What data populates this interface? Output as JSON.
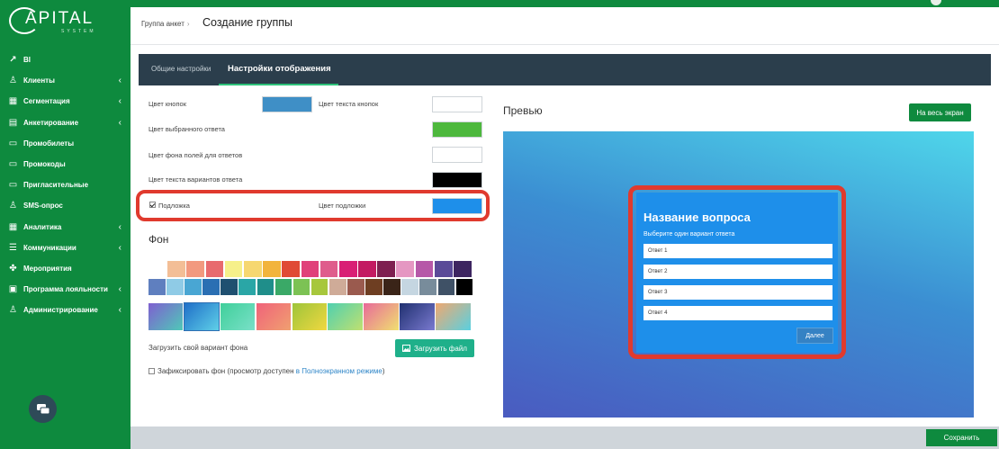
{
  "app": {
    "logo_text": "APITAL",
    "logo_sub": "SYSTEM"
  },
  "sidebar": {
    "items": [
      {
        "label": "BI",
        "icon": "chart-line-icon",
        "chevron": false
      },
      {
        "label": "Клиенты",
        "icon": "user-icon",
        "chevron": true
      },
      {
        "label": "Сегментация",
        "icon": "sitemap-icon",
        "chevron": true
      },
      {
        "label": "Анкетирование",
        "icon": "form-icon",
        "chevron": true
      },
      {
        "label": "Промобилеты",
        "icon": "ticket-icon",
        "chevron": false
      },
      {
        "label": "Промокоды",
        "icon": "ticket-icon",
        "chevron": false
      },
      {
        "label": "Пригласительные",
        "icon": "ticket-icon",
        "chevron": false
      },
      {
        "label": "SMS-опрос",
        "icon": "user-icon",
        "chevron": false
      },
      {
        "label": "Аналитика",
        "icon": "sitemap-icon",
        "chevron": true
      },
      {
        "label": "Коммуникации",
        "icon": "list-icon",
        "chevron": true
      },
      {
        "label": "Мероприятия",
        "icon": "handshake-icon",
        "chevron": false
      },
      {
        "label": "Программа лояльности",
        "icon": "gift-icon",
        "chevron": true
      },
      {
        "label": "Администрирование",
        "icon": "user-icon",
        "chevron": true
      }
    ]
  },
  "header": {
    "breadcrumb": "Группа анкет",
    "breadcrumb_sep": "›",
    "title": "Создание группы"
  },
  "tabs": [
    {
      "label": "Общие настройки",
      "active": false
    },
    {
      "label": "Настройки отображения",
      "active": true
    }
  ],
  "settings": {
    "button_color_label": "Цвет кнопок",
    "button_color": "#3f8fc6",
    "button_text_color_label": "Цвет текста кнопок",
    "button_text_color": "#ffffff",
    "selected_answer_label": "Цвет выбранного ответа",
    "selected_answer_color": "#4db83d",
    "answer_bg_label": "Цвет фона полей для ответов",
    "answer_bg_color": "#ffffff",
    "variant_text_label": "Цвет текста вариантов ответа",
    "variant_text_color": "#000000",
    "underlay_label": "Подложка",
    "underlay_checked": true,
    "underlay_color_label": "Цвет подложки",
    "underlay_color": "#1e8fea",
    "highlight_color": "#e03a2e"
  },
  "background": {
    "title": "Фон",
    "palette_row1": [
      "#ffffff",
      "#f3be96",
      "#f2997f",
      "#e86a6e",
      "#f6f08a",
      "#f6d770",
      "#f2b43c",
      "#e04a35",
      "#e0417a",
      "#df5d8c",
      "#d91f75",
      "#c31a62",
      "#7e2050",
      "#e597c2",
      "#b658a8",
      "#5a4a98",
      "#3d2560"
    ],
    "palette_row2": [
      "#5f7fbf",
      "#8fcbe6",
      "#49a6d3",
      "#2a6fb3",
      "#1f5070",
      "#2aa6a6",
      "#1f8e8a",
      "#3aa967",
      "#7cc254",
      "#a7c73c",
      "#cfab98",
      "#9a5a4e",
      "#6e3e22",
      "#3a2418",
      "#c5d6e1",
      "#788c9b",
      "#3f5166",
      "#000000"
    ],
    "gradients": [
      [
        "#7f5fd0",
        "#4fc9b8"
      ],
      [
        "#1f6fc8",
        "#5fd0e8"
      ],
      [
        "#3fcf9a",
        "#7ae0c8"
      ],
      [
        "#f0627a",
        "#f0a070"
      ],
      [
        "#9ec43a",
        "#f0d840"
      ],
      [
        "#4fd0b0",
        "#c0e070"
      ],
      [
        "#e86a9a",
        "#f0e070"
      ],
      [
        "#203070",
        "#7a7ad0"
      ],
      [
        "#f0a870",
        "#5ad0e0"
      ]
    ],
    "upload_label": "Загрузить свой вариант фона",
    "upload_button": "Загрузить файл",
    "fix_label": "Зафиксировать фон (просмотр доступен ",
    "fix_link": "в Полноэкранном режиме",
    "fix_tail": ")",
    "fix_checked": false
  },
  "preview": {
    "title": "Превью",
    "fullscreen_button": "На весь экран",
    "question_title": "Название вопроса",
    "question_subtitle": "Выберите один вариант ответа",
    "answers": [
      "Ответ 1",
      "Ответ 2",
      "Ответ 3",
      "Ответ 4"
    ],
    "next_button": "Далее"
  },
  "footer": {
    "save_button": "Сохранить"
  }
}
